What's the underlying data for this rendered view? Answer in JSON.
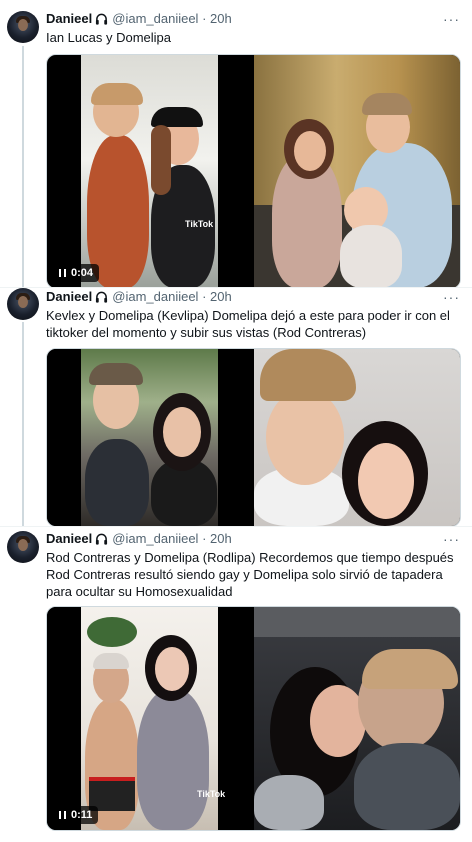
{
  "tweets": [
    {
      "display_name": "Danieel",
      "handle": "@iam_daniieel",
      "dot": "·",
      "time": "20h",
      "text": "Ian Lucas y Domelipa",
      "video_time": "0:04",
      "tiktok_label": "TikTok"
    },
    {
      "display_name": "Danieel",
      "handle": "@iam_daniieel",
      "dot": "·",
      "time": "20h",
      "text": "Kevlex y Domelipa (Kevlipa) Domelipa dejó a este para poder ir con el tiktoker del momento y subir sus vistas (Rod Contreras)"
    },
    {
      "display_name": "Danieel",
      "handle": "@iam_daniieel",
      "dot": "·",
      "time": "20h",
      "text": "Rod Contreras y Domelipa (Rodlipa) Recordemos que tiempo después Rod Contreras resultó siendo gay y Domelipa solo sirvió de tapadera para ocultar su Homosexualidad",
      "video_time": "0:11",
      "tiktok_label": "TikTok"
    }
  ],
  "more_label": "···",
  "icons": {
    "headphones": "headphones-icon",
    "pause": "pause-icon",
    "avatar": "avatar-image"
  }
}
